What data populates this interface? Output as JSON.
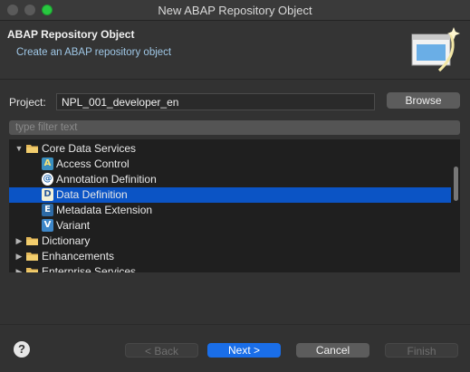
{
  "window": {
    "title": "New ABAP Repository Object"
  },
  "header": {
    "title": "ABAP Repository Object",
    "description": "Create an ABAP repository object"
  },
  "project": {
    "label": "Project:",
    "value": "NPL_001_developer_en",
    "browse_label": "Browse"
  },
  "filter": {
    "placeholder": "type filter text"
  },
  "tree": {
    "items": [
      {
        "label": "Core Data Services",
        "level": 0,
        "expanded": true,
        "icon": "folder-icon"
      },
      {
        "label": "Access Control",
        "level": 1,
        "icon": "access-control-icon",
        "glyph": "A"
      },
      {
        "label": "Annotation Definition",
        "level": 1,
        "icon": "annotation-icon",
        "glyph": "@"
      },
      {
        "label": "Data Definition",
        "level": 1,
        "icon": "data-definition-icon",
        "glyph": "D",
        "selected": true
      },
      {
        "label": "Metadata Extension",
        "level": 1,
        "icon": "metadata-extension-icon",
        "glyph": "E"
      },
      {
        "label": "Variant",
        "level": 1,
        "icon": "variant-icon",
        "glyph": "V"
      },
      {
        "label": "Dictionary",
        "level": 0,
        "expanded": false,
        "icon": "folder-icon"
      },
      {
        "label": "Enhancements",
        "level": 0,
        "expanded": false,
        "icon": "folder-icon"
      },
      {
        "label": "Enterprise Services",
        "level": 0,
        "expanded": false,
        "icon": "folder-icon"
      }
    ]
  },
  "buttons": {
    "help": "?",
    "back": "< Back",
    "next": "Next >",
    "cancel": "Cancel",
    "finish": "Finish"
  },
  "colors": {
    "selection": "#0b54c5",
    "primary_button": "#1a6ee8",
    "description_text": "#9fc7e6"
  }
}
